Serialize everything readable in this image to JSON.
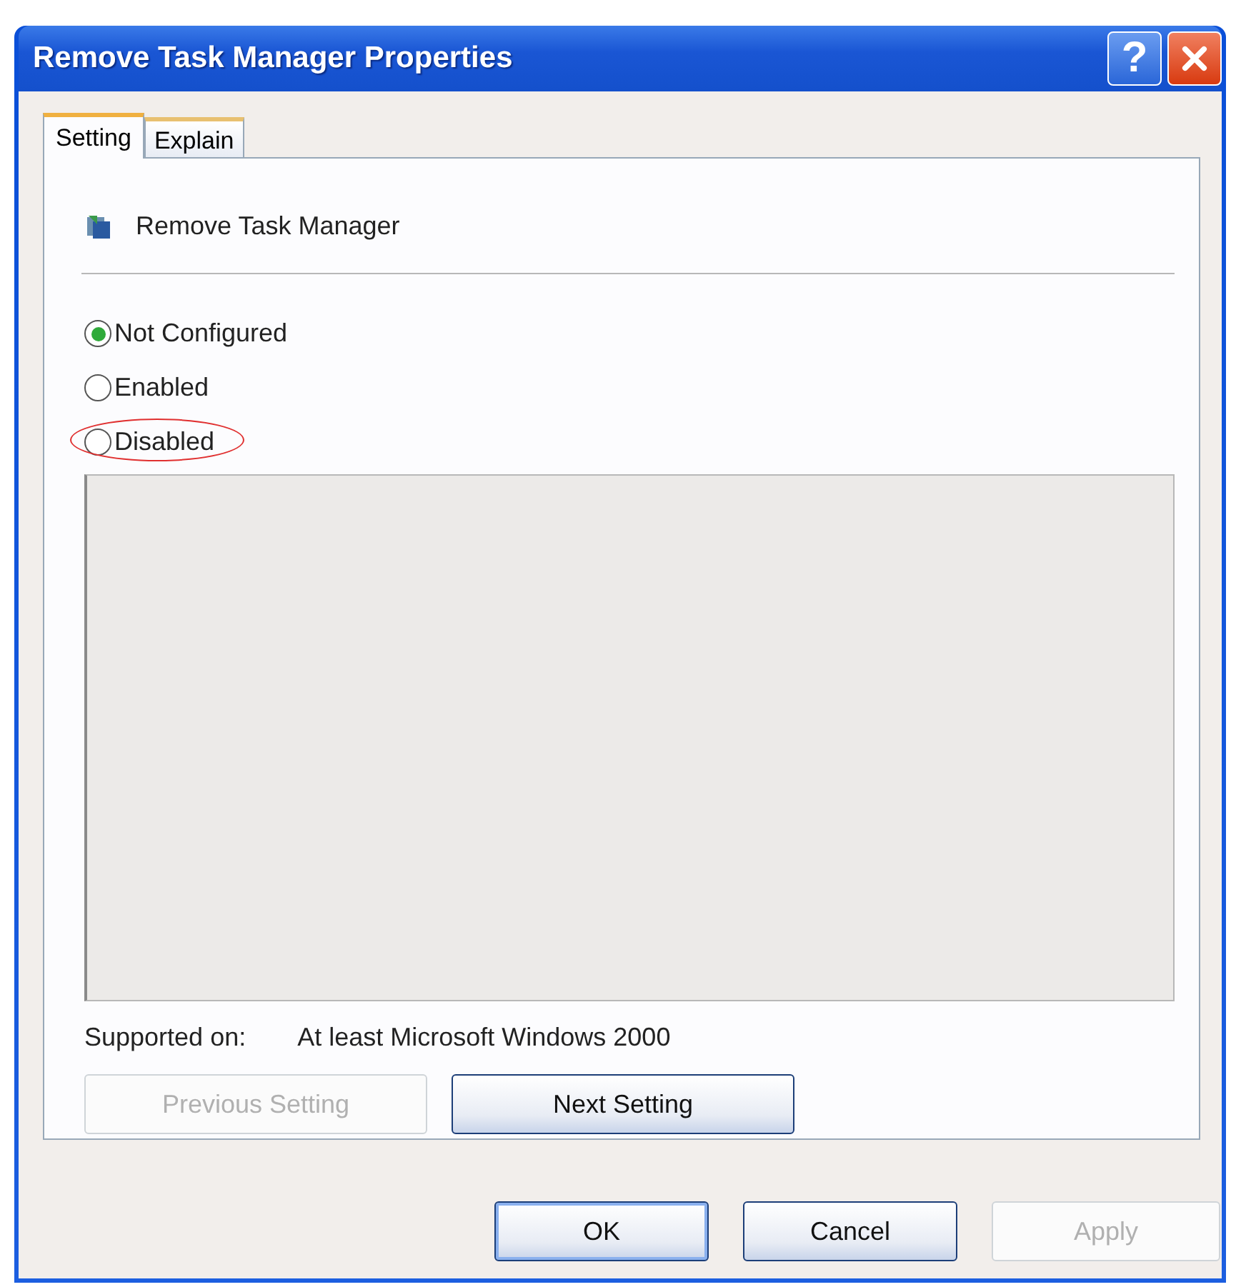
{
  "window": {
    "title": "Remove Task Manager Properties"
  },
  "title_buttons": [
    {
      "kind": "help",
      "label": "?"
    },
    {
      "kind": "close"
    }
  ],
  "tabs": [
    {
      "label": "Setting",
      "selected": true
    },
    {
      "label": "Explain",
      "selected": false
    }
  ],
  "policy": {
    "name": "Remove Task Manager"
  },
  "options": [
    {
      "label": "Not Configured",
      "selected": true,
      "circled": false
    },
    {
      "label": "Enabled",
      "selected": false,
      "circled": false
    },
    {
      "label": "Disabled",
      "selected": false,
      "circled": true
    }
  ],
  "supported": {
    "label": "Supported on:",
    "value": "At least Microsoft Windows 2000"
  },
  "nav_buttons": [
    {
      "label": "Previous Setting",
      "disabled": true
    },
    {
      "label": "Next Setting",
      "disabled": false
    }
  ],
  "buttons": [
    {
      "label": "OK",
      "disabled": false,
      "default": true
    },
    {
      "label": "Cancel",
      "disabled": false,
      "default": false
    },
    {
      "label": "Apply",
      "disabled": true,
      "default": false
    }
  ]
}
